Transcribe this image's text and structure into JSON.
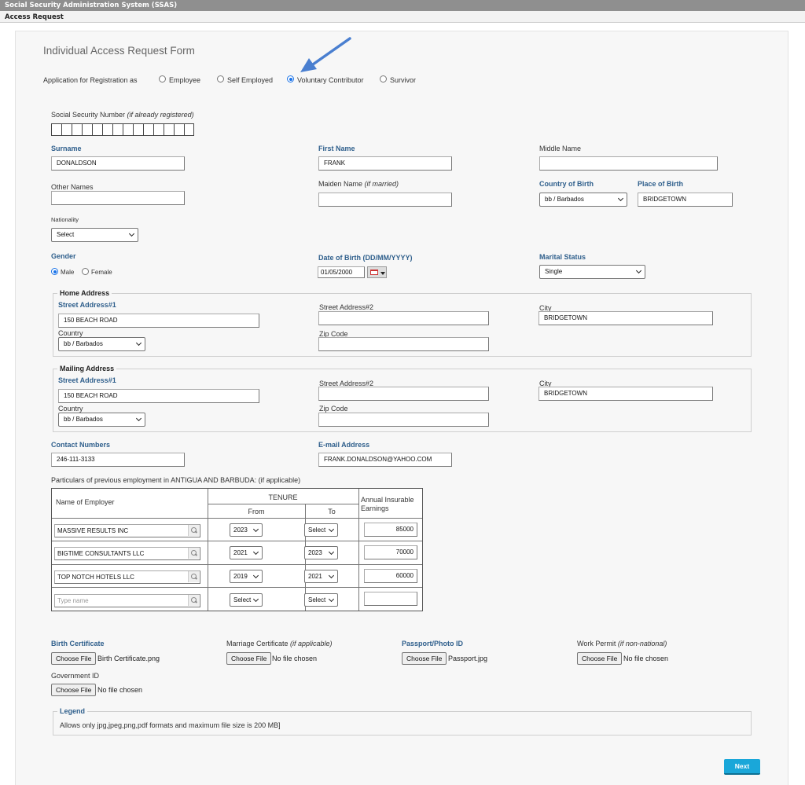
{
  "header": {
    "system_title": "Social Security Administration System (SSAS)",
    "breadcrumb": "Access Request"
  },
  "form": {
    "title": "Individual Access Request Form",
    "registration_label": "Application for Registration as",
    "registration_options": [
      "Employee",
      "Self Employed",
      "Voluntary Contributor",
      "Survivor"
    ],
    "registration_selected": "Voluntary Contributor",
    "ssn_label": "Social Security Number ",
    "ssn_hint": "(if already registered)",
    "surname_label": "Surname",
    "surname": "DONALDSON",
    "first_name_label": "First Name",
    "first_name": "FRANK",
    "middle_name_label": "Middle Name",
    "middle_name": "",
    "other_names_label": "Other Names",
    "other_names": "",
    "maiden_name_label": "Maiden Name ",
    "maiden_name_hint": "(if married)",
    "maiden_name": "",
    "country_of_birth_label": "Country of Birth",
    "country_of_birth": "bb / Barbados",
    "place_of_birth_label": "Place of Birth",
    "place_of_birth": "BRIDGETOWN",
    "nationality_label": "Nationality",
    "nationality": "Select",
    "gender_label": "Gender",
    "gender_options": [
      "Male",
      "Female"
    ],
    "gender_selected": "Male",
    "dob_label": "Date of Birth ",
    "dob_format": "(DD/MM/YYYY)",
    "dob": "01/05/2000",
    "marital_status_label": "Marital Status",
    "marital_status": "Single"
  },
  "home_address": {
    "legend": "Home Address",
    "street1_label": "Street Address#1",
    "street1": "150 BEACH ROAD",
    "street2_label": "Street Address#2",
    "street2": "",
    "city_label": "City",
    "city": "BRIDGETOWN",
    "country_label": "Country",
    "country": "bb / Barbados",
    "zip_label": "Zip Code",
    "zip": ""
  },
  "mailing_address": {
    "legend": "Mailing Address",
    "street1_label": "Street Address#1",
    "street1": "150 BEACH ROAD",
    "street2_label": "Street Address#2",
    "street2": "",
    "city_label": "City",
    "city": "BRIDGETOWN",
    "country_label": "Country",
    "country": "bb / Barbados",
    "zip_label": "Zip Code",
    "zip": ""
  },
  "contact": {
    "contact_label": "Contact Numbers",
    "contact": "246-111-3133",
    "email_label": "E-mail Address",
    "email": "FRANK.DONALDSON@YAHOO.COM"
  },
  "employment": {
    "caption": "Particulars of previous employment in ANTIGUA AND BARBUDA: (if applicable)",
    "col_employer": "Name of Employer",
    "col_tenure": "TENURE",
    "col_from": "From",
    "col_to": "To",
    "col_earnings": "Annual Insurable Earnings",
    "rows": [
      {
        "employer": "MASSIVE RESULTS INC",
        "from": "2023",
        "to": "Select",
        "earnings": "85000"
      },
      {
        "employer": "BIGTIME CONSULTANTS LLC",
        "from": "2021",
        "to": "2023",
        "earnings": "70000"
      },
      {
        "employer": "TOP NOTCH HOTELS LLC",
        "from": "2019",
        "to": "2021",
        "earnings": "60000"
      },
      {
        "employer": "",
        "placeholder": "Type name",
        "from": "Select",
        "to": "Select",
        "earnings": ""
      }
    ]
  },
  "documents": {
    "choose_label": "Choose File",
    "birth_label": "Birth Certificate",
    "birth_file": "Birth Certificate.png",
    "marriage_label": "Marriage Certificate ",
    "marriage_hint": "(if applicable)",
    "marriage_file": "No file chosen",
    "passport_label": "Passport/Photo ID",
    "passport_file": "Passport.jpg",
    "permit_label": "Work Permit ",
    "permit_hint": "(if non-national)",
    "permit_file": "No file chosen",
    "gov_label": "Government ID",
    "gov_file": "No file chosen"
  },
  "legend_box": {
    "title": "Legend",
    "text": "Allows only jpg,jpeg,png,pdf formats and maximum file size is 200 MB]"
  },
  "actions": {
    "next": "Next"
  },
  "colors": {
    "accent": "#1aa7d9",
    "label_blue": "#2f5f8c",
    "arrow": "#4a7fd0"
  }
}
